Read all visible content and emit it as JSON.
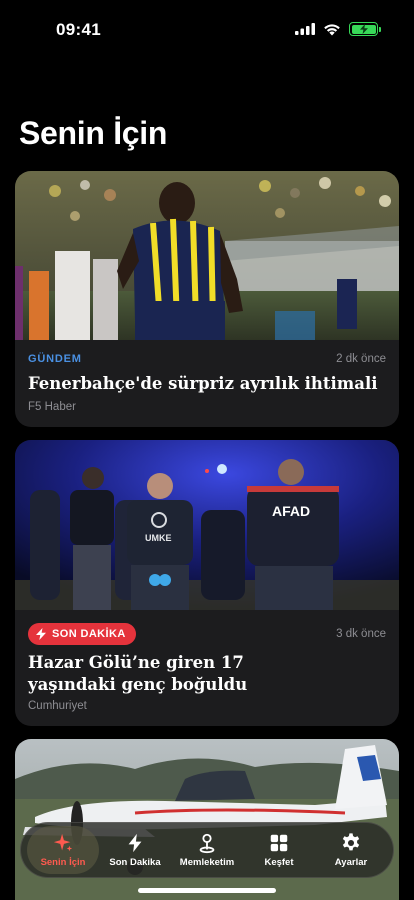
{
  "status_bar": {
    "time": "09:41"
  },
  "page": {
    "title": "Senin İçin"
  },
  "articles": [
    {
      "category": "GÜNDEM",
      "time_ago": "2 dk önce",
      "headline": "Fenerbahçe'de sürpriz ayrılık ihtimali",
      "source": "F5 Haber"
    },
    {
      "badge": "SON DAKİKA",
      "time_ago": "3 dk önce",
      "headline": "Hazar Gölü’ne giren 17 yaşındaki genç boğuldu",
      "source": "Cumhuriyet"
    },
    {
      "image": "small aircraft on airfield"
    }
  ],
  "photo_text": {
    "afad": "AFAD",
    "umke": "UMKE"
  },
  "tab_bar": {
    "items": [
      {
        "label": "Senin İçin",
        "icon": "sparkle-icon",
        "active": true
      },
      {
        "label": "Son Dakika",
        "icon": "bolt-icon",
        "active": false
      },
      {
        "label": "Memleketim",
        "icon": "location-pin-icon",
        "active": false
      },
      {
        "label": "Keşfet",
        "icon": "grid-icon",
        "active": false
      },
      {
        "label": "Ayarlar",
        "icon": "gear-icon",
        "active": false
      }
    ]
  },
  "colors": {
    "accent_blue": "#4a90e2",
    "breaking_red": "#e5333c",
    "active_tab": "#ff5a4f",
    "battery_green": "#38d958"
  }
}
